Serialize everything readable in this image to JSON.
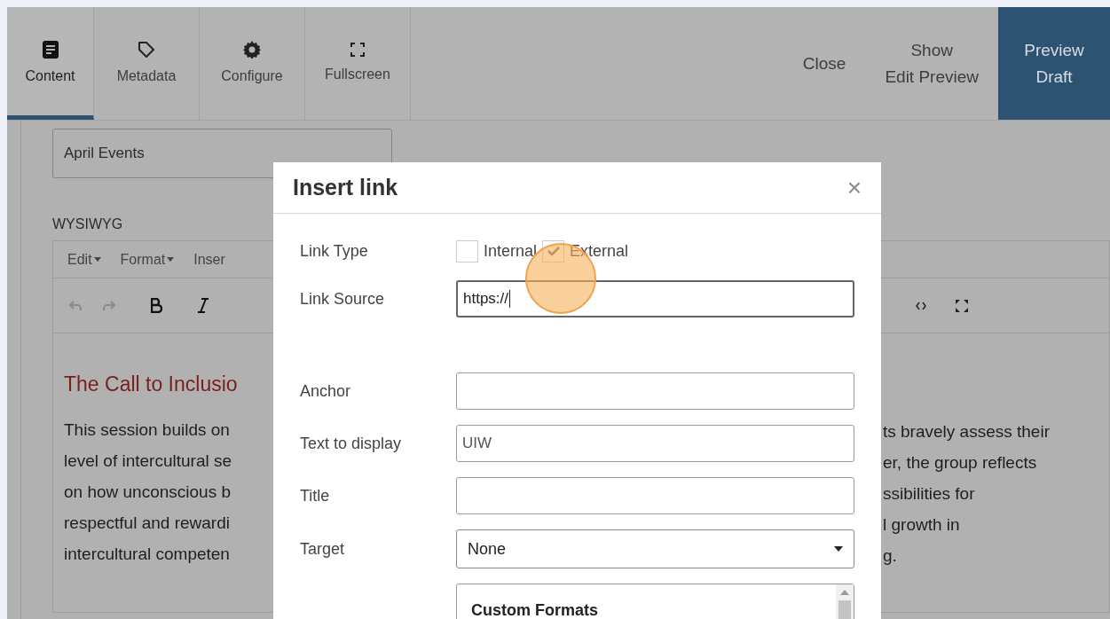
{
  "top_tabs": [
    {
      "label": "Content",
      "selected": true
    },
    {
      "label": "Metadata",
      "selected": false
    },
    {
      "label": "Configure",
      "selected": false
    },
    {
      "label": "Fullscreen",
      "selected": false
    }
  ],
  "top_actions": [
    {
      "label": "Close",
      "kind": "plain"
    },
    {
      "label": "Show\nEdit Preview",
      "kind": "plain"
    },
    {
      "label": "Preview\nDraft",
      "kind": "primary"
    }
  ],
  "title_field": {
    "value": "April Events"
  },
  "editor": {
    "label": "WYSIWYG",
    "menu": [
      "Edit",
      "Format",
      "Inser"
    ],
    "heading": "The Call to Inclusio",
    "lines_left": [
      "This session builds on",
      "level of intercultural se",
      "on how unconscious b",
      "respectful and rewardi",
      "intercultural competen"
    ],
    "lines_right": [
      "ts bravely assess their",
      "er, the group reflects",
      "ssibilities for",
      "l growth in",
      "g."
    ]
  },
  "dialog": {
    "title": "Insert link",
    "close": "×",
    "link_type": {
      "label": "Link Type",
      "options": [
        {
          "label": "Internal",
          "checked": false
        },
        {
          "label": "External",
          "checked": true
        }
      ]
    },
    "fields": [
      {
        "label": "Link Source",
        "value": "https://",
        "kind": "input",
        "focused": true
      },
      {
        "label": "Anchor",
        "kind": "input",
        "focused": false
      },
      {
        "label": "Text to display",
        "value": "UIW",
        "kind": "input",
        "focused": false
      },
      {
        "label": "Title",
        "kind": "input",
        "focused": false
      },
      {
        "label": "Target",
        "value": "None",
        "kind": "select"
      }
    ],
    "format_list": {
      "heading": "Custom Formats"
    }
  }
}
